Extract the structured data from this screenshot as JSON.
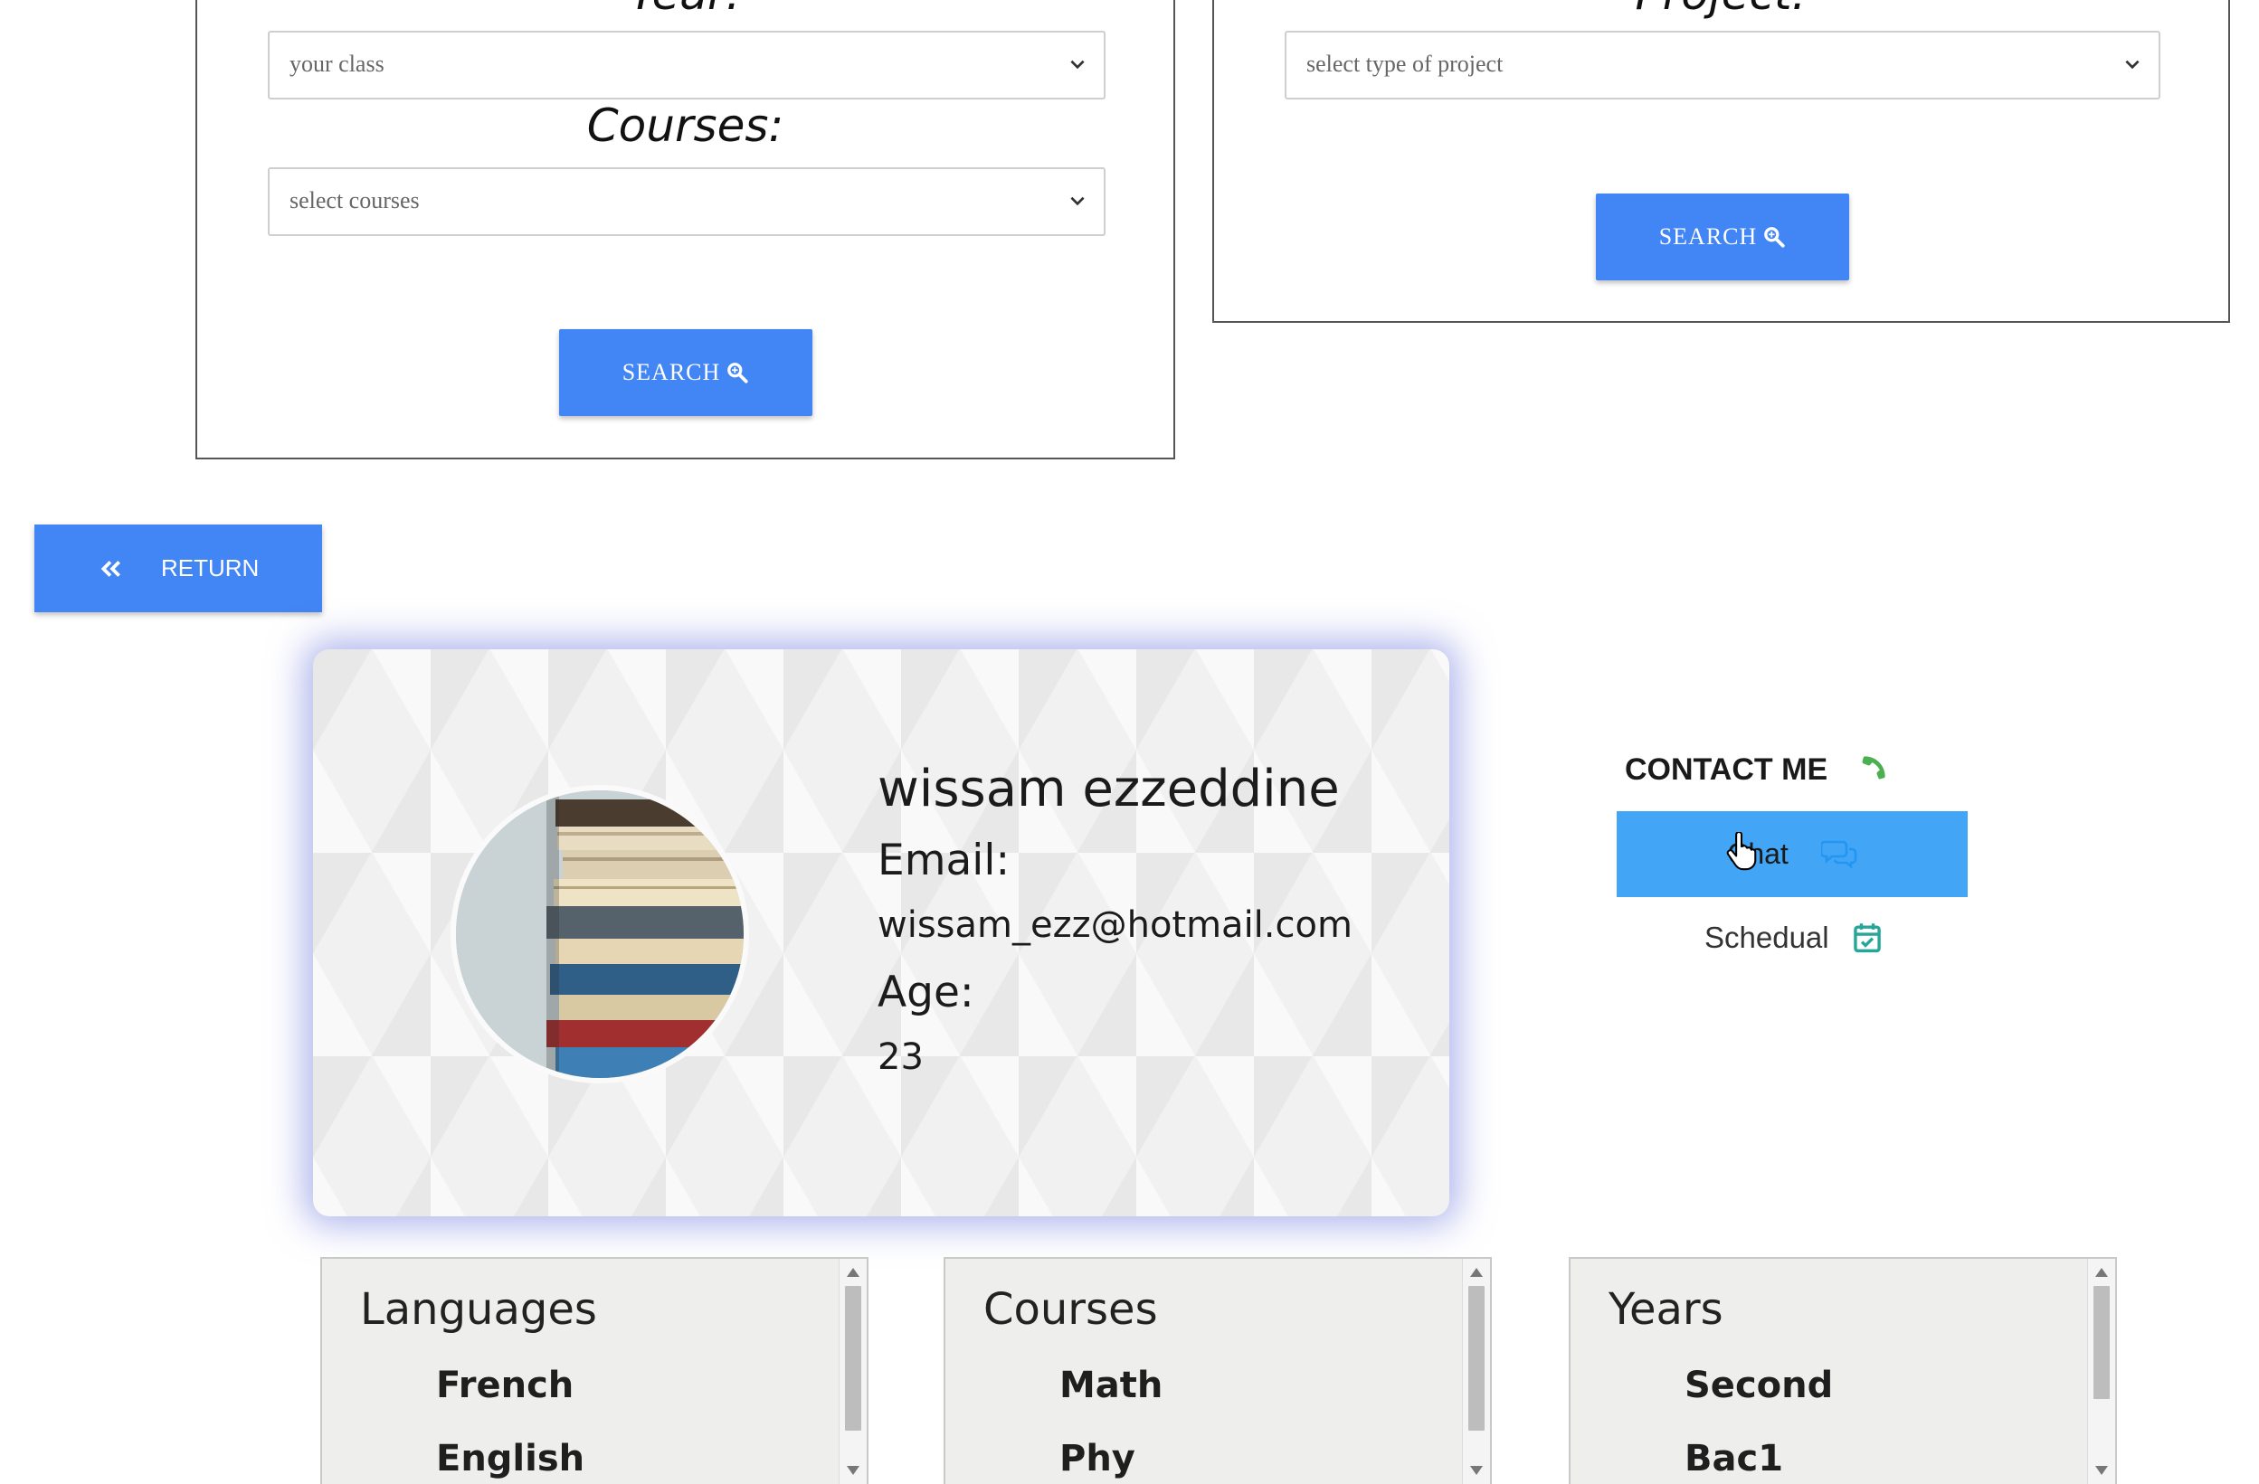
{
  "left_panel": {
    "year_heading": "Year:",
    "year_select": "your class",
    "courses_heading": "Courses:",
    "courses_select": "select courses",
    "search_label": "SEARCH"
  },
  "right_panel": {
    "project_heading": "Project:",
    "project_select": "select type of project",
    "search_label": "SEARCH"
  },
  "return_label": "RETURN",
  "profile": {
    "name": "wissam ezzeddine",
    "email_label": "Email:",
    "email": "wissam_ezz@hotmail.com",
    "age_label": "Age:",
    "age": "23"
  },
  "contact": {
    "title": "CONTACT ME",
    "chat_label": "Chat",
    "schedule_label": "Schedual"
  },
  "lists": {
    "languages": {
      "title": "Languages",
      "items": [
        "French",
        "English"
      ]
    },
    "courses": {
      "title": "Courses",
      "items": [
        "Math",
        "Phy"
      ]
    },
    "years": {
      "title": "Years",
      "items": [
        "Second",
        "Bac1"
      ]
    }
  },
  "colors": {
    "primary_button": "#4285f4",
    "chat_button": "#42a5f5",
    "phone_icon": "#4caf50",
    "calendar_icon": "#26a69a",
    "card_glow": "#6e78dc"
  },
  "icons": {
    "search": "search-icon",
    "return": "double-chevron-left-icon",
    "phone": "phone-icon",
    "chat": "chat-bubbles-icon",
    "calendar": "calendar-check-icon",
    "cursor": "hand-pointer-icon"
  }
}
